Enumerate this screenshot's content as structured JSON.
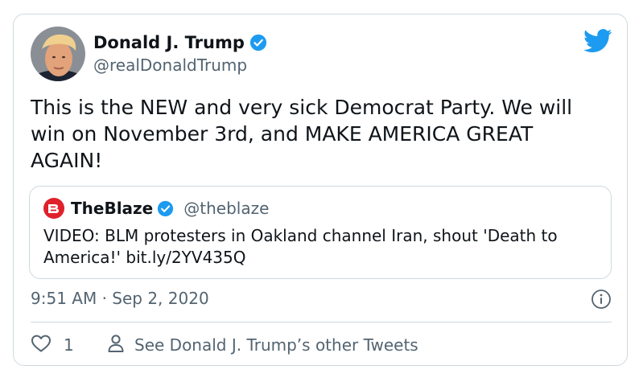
{
  "tweet": {
    "author_name": "Donald J. Trump",
    "author_handle": "@realDonaldTrump",
    "text": "This is the NEW and very sick Democrat Party. We will\nwin on November 3rd, and MAKE AMERICA GREAT\nAGAIN!",
    "timestamp": "9:51 AM · Sep 2, 2020",
    "like_count": "1",
    "other_tweets_label": "See Donald J. Trump’s other Tweets"
  },
  "quote": {
    "author_name": "TheBlaze",
    "author_handle": "@theblaze",
    "text": "VIDEO: BLM protesters in Oakland channel Iran, shout 'Death to America!' bit.ly/2YV435Q"
  },
  "colors": {
    "twitter_blue": "#1d9bf0",
    "text_primary": "#0f1419",
    "text_secondary": "#536471",
    "border": "#cfd9de",
    "blaze_red": "#e0202a"
  },
  "icons": {
    "brand": "twitter-bird-icon",
    "verified": "verified-badge-icon",
    "info": "info-icon",
    "like": "heart-icon",
    "profile": "person-icon"
  }
}
